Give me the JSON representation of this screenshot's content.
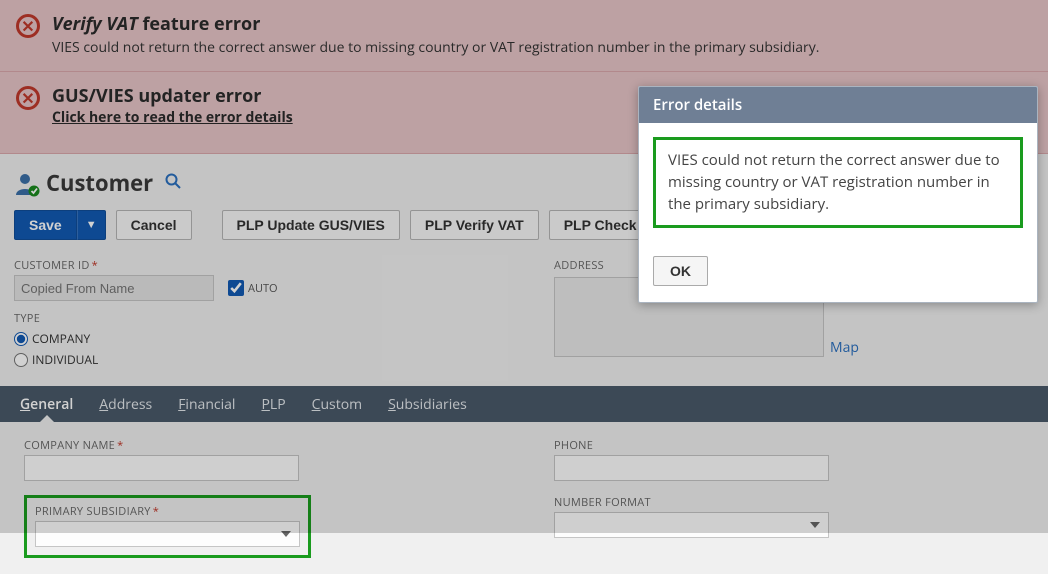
{
  "banners": [
    {
      "title_prefix": "Verify VAT",
      "title_suffix": " feature error",
      "sub": "VIES could not return the correct answer due to missing country or VAT registration number in the primary subsidiary."
    },
    {
      "title": "GUS/VIES updater error",
      "link": "Click here to read the error details"
    }
  ],
  "entity": {
    "title": "Customer"
  },
  "buttons": {
    "save": "Save",
    "cancel": "Cancel",
    "plp_update": "PLP Update GUS/VIES",
    "plp_verify": "PLP Verify VAT",
    "plp_whitelist": "PLP Check whitelist"
  },
  "form": {
    "customer_id_label": "CUSTOMER ID",
    "customer_id_placeholder": "Copied From Name",
    "auto_label": "AUTO",
    "auto_checked": true,
    "type_label": "TYPE",
    "type_company": "COMPANY",
    "type_individual": "INDIVIDUAL",
    "type_selected": "COMPANY",
    "address_label": "ADDRESS",
    "map_link": "Map"
  },
  "tabs": [
    "General",
    "Address",
    "Financial",
    "PLP",
    "Custom",
    "Subsidiaries"
  ],
  "tab_active": 0,
  "general": {
    "company_name_label": "COMPANY NAME",
    "primary_subsidiary_label": "PRIMARY SUBSIDIARY",
    "phone_label": "PHONE",
    "number_format_label": "NUMBER FORMAT"
  },
  "modal": {
    "title": "Error details",
    "message": "VIES could not return the correct answer due to missing country or VAT registration number in the primary subsidiary.",
    "ok": "OK"
  }
}
